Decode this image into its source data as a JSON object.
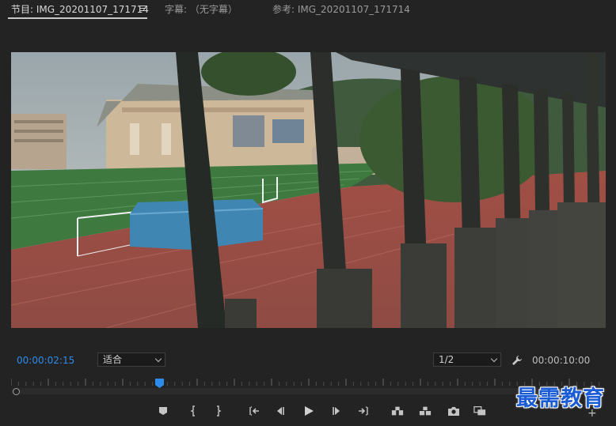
{
  "tabs": {
    "program": "节目: IMG_20201107_171714",
    "captions": "字幕: （无字幕）",
    "reference": "参考: IMG_20201107_171714"
  },
  "controls": {
    "current_timecode": "00:00:02:15",
    "fit_label": "适合",
    "resolution_label": "1/2",
    "duration_timecode": "00:00:10:00"
  },
  "scrub": {
    "playhead_fraction": 0.25
  },
  "transport": [
    {
      "name": "add-marker-icon"
    },
    {
      "name": "mark-in-icon"
    },
    {
      "name": "mark-out-icon"
    },
    {
      "name": "go-to-in-icon"
    },
    {
      "name": "step-back-icon"
    },
    {
      "name": "play-icon"
    },
    {
      "name": "step-forward-icon"
    },
    {
      "name": "go-to-out-icon"
    },
    {
      "name": "lift-icon"
    },
    {
      "name": "extract-icon"
    },
    {
      "name": "export-frame-icon"
    },
    {
      "name": "compare-view-icon"
    }
  ],
  "watermark": "最需教育",
  "colors": {
    "accent_blue": "#2d8ceb",
    "panel_bg": "#232323"
  }
}
